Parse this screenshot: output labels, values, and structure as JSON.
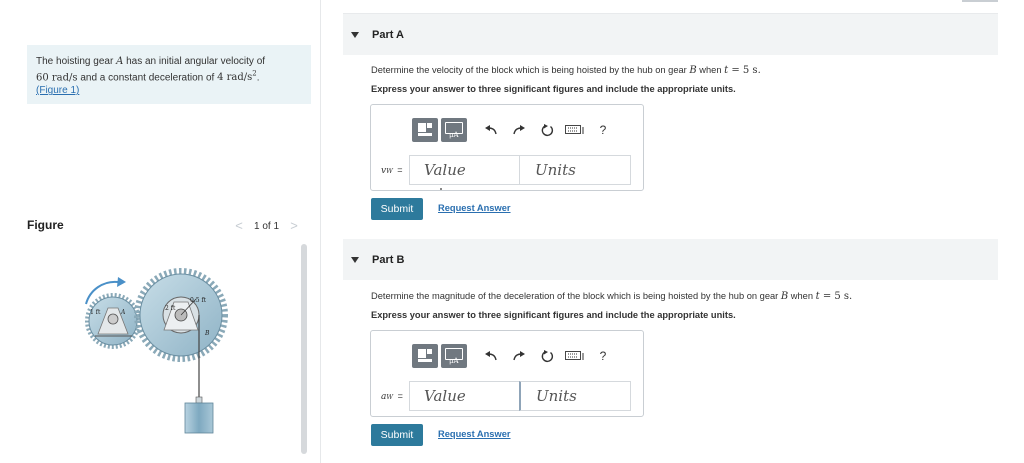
{
  "problem": {
    "text_before_A": "The hoisting gear ",
    "gear_A": "A",
    "text_has_initial": " has an initial angular velocity of",
    "omega_value": "60 rad/s",
    "text_and_decel": " and a constant deceleration of ",
    "alpha_value": "4 rad/s",
    "alpha_exp": "2",
    "period": ".",
    "figure_link": "(Figure 1)"
  },
  "figure": {
    "label": "Figure",
    "pager_text": "1 of 1",
    "prev_glyph": "<",
    "next_glyph": ">",
    "labels": {
      "r_A": "1 ft",
      "gear_A": "A",
      "r_B": "2 ft",
      "hub": "0.5 ft",
      "gear_B": "B"
    }
  },
  "parts": [
    {
      "title": "Part A",
      "question_pre": "Determine the velocity of the block which is being hoisted by the hub on gear ",
      "question_gear": "B",
      "question_mid": " when ",
      "question_t": "t",
      "question_post": " = 5 s.",
      "instruction": "Express your answer to three significant figures and include the appropriate units.",
      "var_main": "v",
      "var_sub": "W",
      "var_eq": " =",
      "value_placeholder": "Value",
      "units_placeholder": "Units",
      "submit_label": "Submit",
      "request_label": "Request Answer"
    },
    {
      "title": "Part B",
      "question_pre": "Determine the magnitude of the deceleration of the block which is being hoisted by the hub on gear ",
      "question_gear": "B",
      "question_mid": " when ",
      "question_t": "t",
      "question_post": " = 5 s.",
      "instruction": "Express your answer to three significant figures and include the appropriate units.",
      "var_main": "a",
      "var_sub": "W",
      "var_eq": " =",
      "value_placeholder": "Value",
      "units_placeholder": "Units",
      "submit_label": "Submit",
      "request_label": "Request Answer"
    }
  ],
  "toolbar": {
    "templates_icon": "templates-icon",
    "units_icon": "units-mu-icon",
    "units_glyph": "μA",
    "undo_icon": "undo-icon",
    "redo_icon": "redo-icon",
    "reset_icon": "reset-icon",
    "keyboard_icon": "keyboard-icon",
    "help_glyph": "?"
  },
  "colors": {
    "submit_bg": "#2d7a9c",
    "link": "#2a6fb0",
    "problem_bg": "#eaf3f6",
    "part_header_bg": "#f2f4f5",
    "gear_fill": "#a7c4d2",
    "block_fill": "#8eb5cb"
  }
}
